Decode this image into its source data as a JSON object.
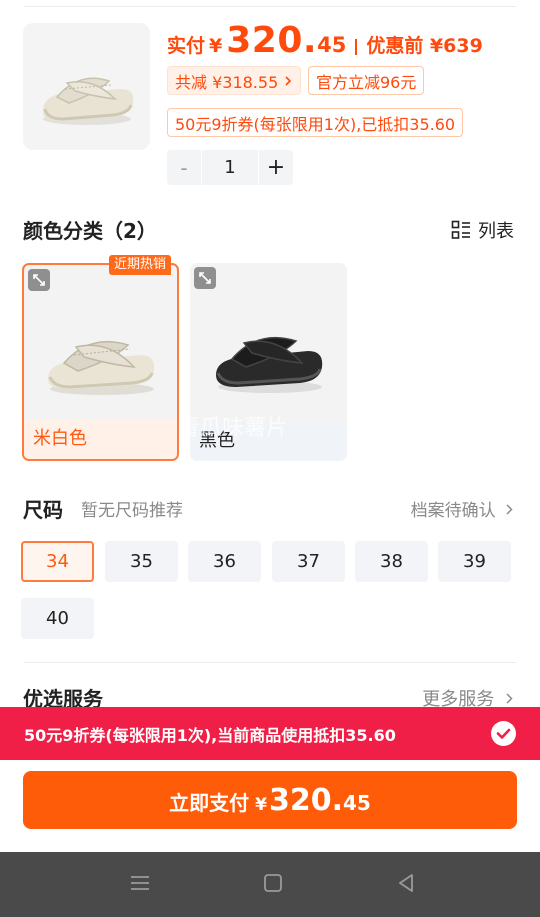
{
  "product": {
    "paid_label": "实付",
    "currency": "¥",
    "price_int": "320.",
    "price_dec": "45",
    "original_label": "优惠前 ¥639",
    "total_discount": "共减 ¥318.55",
    "official_discount": "官方立减96元",
    "coupon_tag": "50元9折券(每张限用1次),已抵扣35.60",
    "quantity": "1",
    "minus": "-",
    "plus": "+"
  },
  "color_section": {
    "title": "颜色分类（2）",
    "list_label": "列表",
    "hot_badge": "近期热销",
    "options": [
      {
        "label": "米白色",
        "selected": true
      },
      {
        "label": "黑色",
        "selected": false
      }
    ],
    "watermark": "青瓜味薯片"
  },
  "size_section": {
    "title": "尺码",
    "subtitle": "暂无尺码推荐",
    "link": "档案待确认",
    "sizes": [
      "34",
      "35",
      "36",
      "37",
      "38",
      "39",
      "40"
    ],
    "selected": "34"
  },
  "service_section": {
    "title": "优选服务",
    "more": "更多服务"
  },
  "coupon_bar": {
    "text": "50元9折券(每张限用1次),当前商品使用抵扣35.60"
  },
  "pay": {
    "label": "立即支付",
    "currency": "¥",
    "int": "320.",
    "dec": "45"
  },
  "colors": {
    "accent": "#ff5c0a",
    "price": "#ff4a0d",
    "coupon_bar": "#ef1f47",
    "navbar": "#4a4a4a"
  },
  "icons": [
    "zoom-icon",
    "list-view-icon",
    "chevron-right-icon",
    "check-circle-icon",
    "menu-icon",
    "home-icon",
    "back-icon"
  ]
}
